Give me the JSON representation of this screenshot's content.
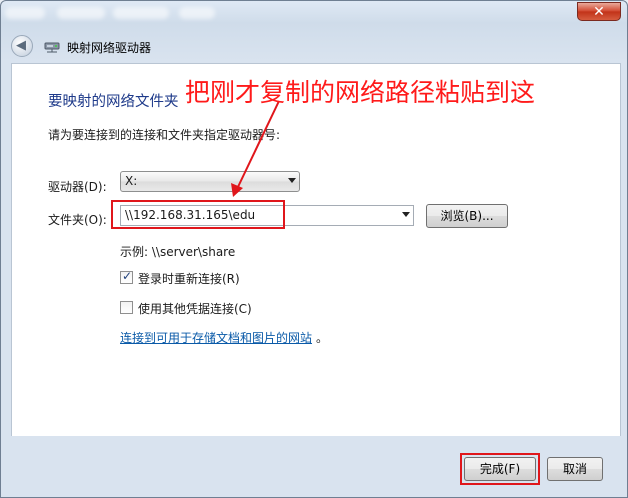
{
  "window": {
    "close_glyph": "✕"
  },
  "nav": {
    "back_glyph": "◀",
    "title": "映射网络驱动器"
  },
  "content": {
    "heading": "要映射的网络文件夹",
    "instruction": "请为要连接到的连接和文件夹指定驱动器号:",
    "drive_label": "驱动器(D):",
    "drive_value": "X:",
    "folder_label": "文件夹(O):",
    "folder_value": "\\\\192.168.31.165\\edu",
    "browse_label": "浏览(B)...",
    "example_text": "示例: \\\\server\\share",
    "reconnect_label": "登录时重新连接(R)",
    "reconnect_checked": true,
    "other_credentials_label": "使用其他凭据连接(C)",
    "other_credentials_checked": false,
    "link_text": "连接到可用于存储文档和图片的网站",
    "link_suffix": "。"
  },
  "annotation": {
    "text": "把刚才复制的网络路径粘贴到这",
    "color": "#e0161b"
  },
  "footer": {
    "finish_label": "完成(F)",
    "cancel_label": "取消"
  }
}
